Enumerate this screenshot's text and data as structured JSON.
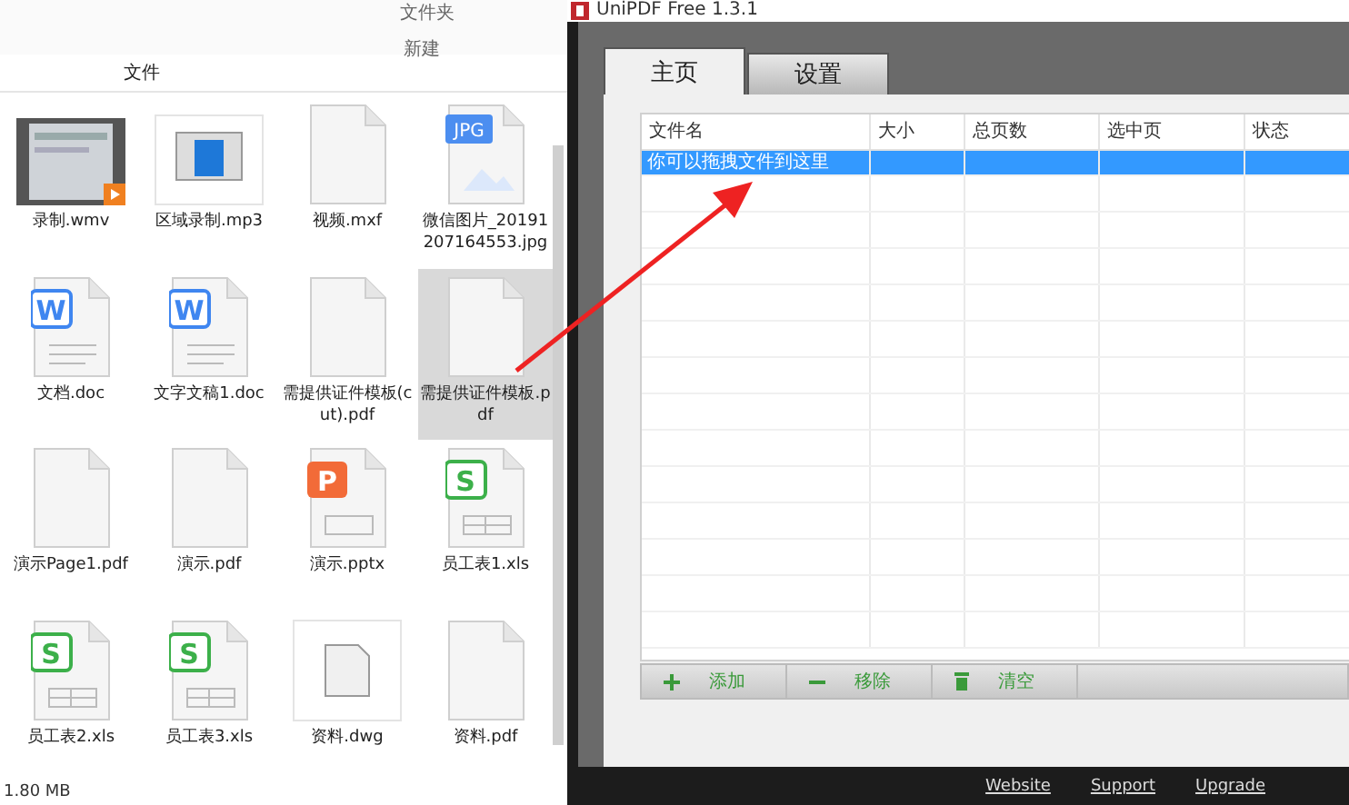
{
  "explorer": {
    "ribbon": {
      "items": [
        "文件夹",
        "新建"
      ]
    },
    "breadcrumb": "文件",
    "files": [
      {
        "name": "录制.wmv",
        "kind": "video",
        "selected": false
      },
      {
        "name": "区域录制.mp3",
        "kind": "window",
        "selected": false
      },
      {
        "name": "视频.mxf",
        "kind": "blank",
        "selected": false
      },
      {
        "name": "微信图片_20191207164553.jpg",
        "kind": "jpg",
        "label": "JPG",
        "selected": false
      },
      {
        "name": "文档.doc",
        "kind": "word",
        "label": "W",
        "selected": false
      },
      {
        "name": "文字文稿1.doc",
        "kind": "word",
        "label": "W",
        "selected": false
      },
      {
        "name": "需提供证件模板(cut).pdf",
        "kind": "blank",
        "selected": false
      },
      {
        "name": "需提供证件模板.pdf",
        "kind": "blank",
        "selected": true
      },
      {
        "name": "演示Page1.pdf",
        "kind": "blank",
        "selected": false
      },
      {
        "name": "演示.pdf",
        "kind": "blank",
        "selected": false
      },
      {
        "name": "演示.pptx",
        "kind": "ppt",
        "label": "P",
        "selected": false
      },
      {
        "name": "员工表1.xls",
        "kind": "xls",
        "label": "S",
        "selected": false
      },
      {
        "name": "员工表2.xls",
        "kind": "xls",
        "label": "S",
        "selected": false
      },
      {
        "name": "员工表3.xls",
        "kind": "xls",
        "label": "S",
        "selected": false
      },
      {
        "name": "资料.dwg",
        "kind": "dwg",
        "selected": false
      },
      {
        "name": "资料.pdf",
        "kind": "blank",
        "selected": false
      }
    ],
    "status_bar": "1.80 MB"
  },
  "app": {
    "window": {
      "title": "UniPDF Free 1.3.1"
    },
    "tabs": [
      {
        "label": "主页",
        "selected": true
      },
      {
        "label": "设置",
        "selected": false
      }
    ],
    "table": {
      "columns": [
        "文件名",
        "大小",
        "总页数",
        "选中页",
        "状态"
      ],
      "rows": [
        {
          "cells": [
            "你可以拖拽文件到这里",
            "",
            "",
            "",
            ""
          ],
          "selected": true
        }
      ]
    },
    "buttons": [
      {
        "label": "添加",
        "kind": "add"
      },
      {
        "label": "移除",
        "kind": "remove"
      },
      {
        "label": "清空",
        "kind": "clear"
      }
    ],
    "footer_links": [
      "Website",
      "Support",
      "Upgrade"
    ]
  }
}
